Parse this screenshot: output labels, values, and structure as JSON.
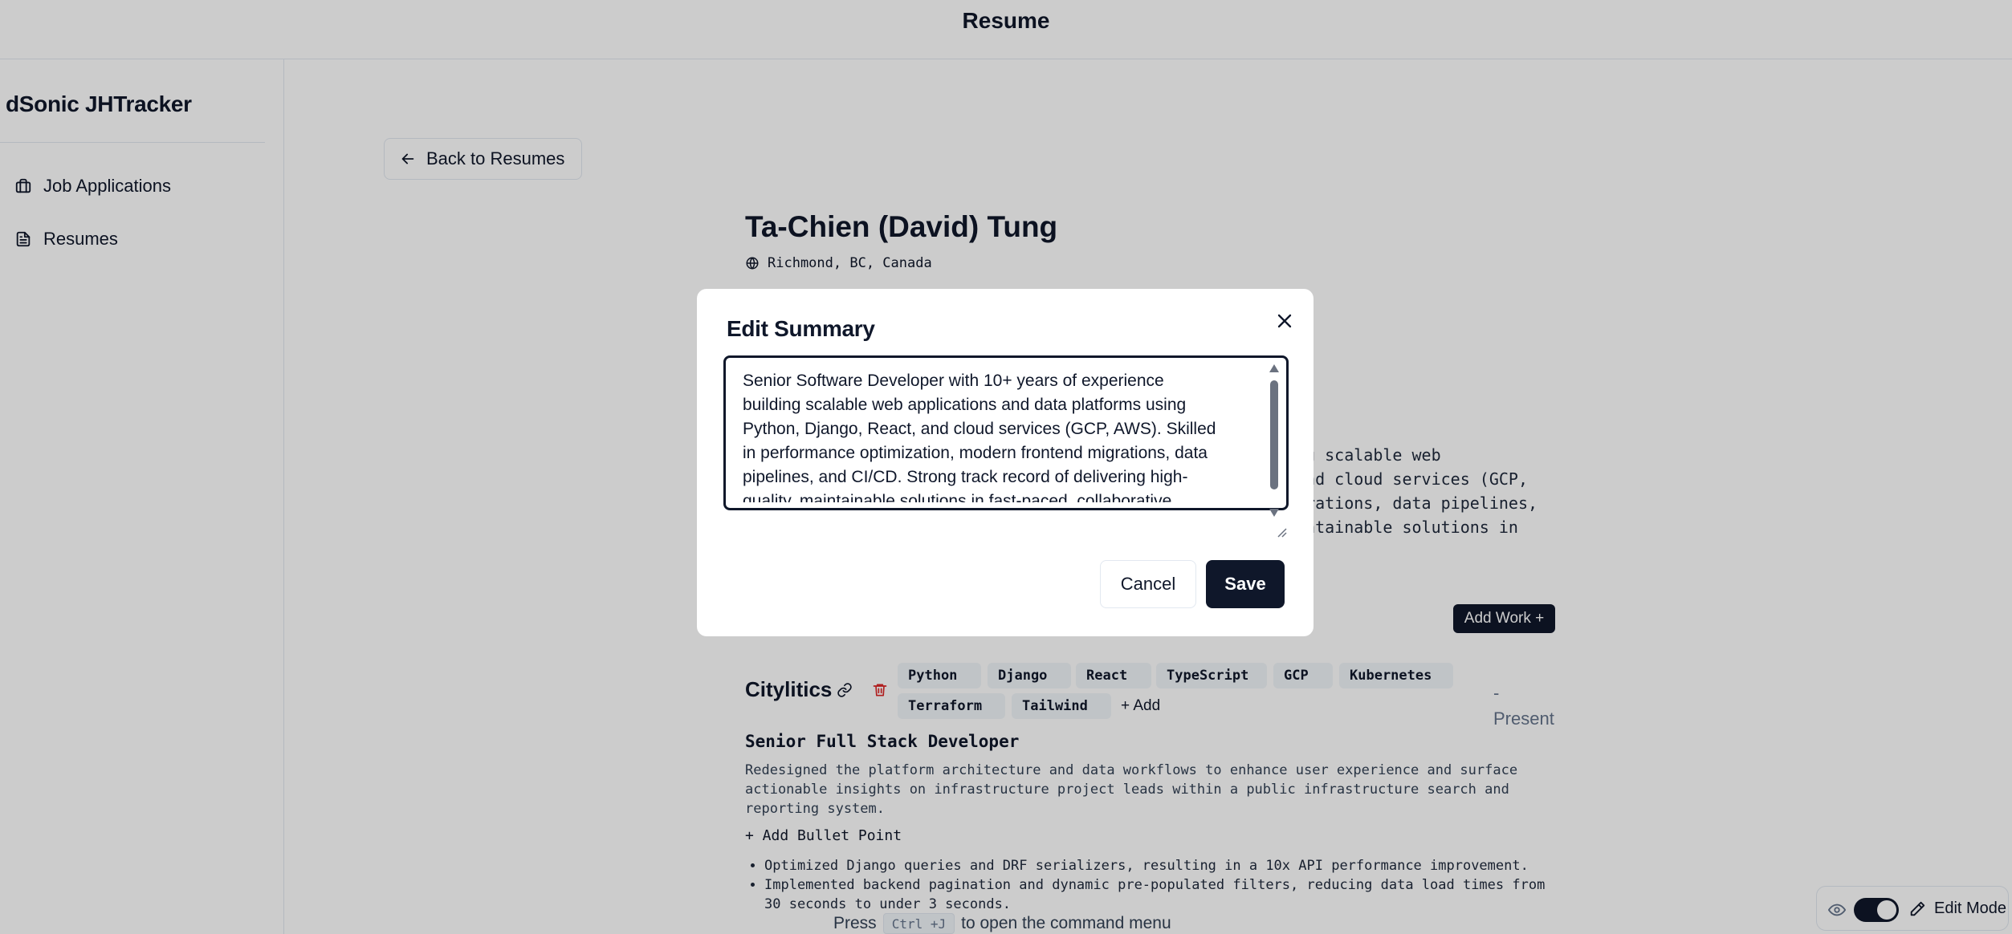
{
  "header": {
    "title": "Resume"
  },
  "sidebar": {
    "brand": "dSonic JHTracker",
    "items": [
      {
        "label": "Job Applications",
        "icon": "briefcase-icon"
      },
      {
        "label": "Resumes",
        "icon": "document-icon"
      }
    ]
  },
  "back_button": {
    "label": "Back to Resumes",
    "icon": "arrow-left-icon"
  },
  "resume": {
    "name": "Ta-Chien (David) Tung",
    "location": "Richmond, BC, Canada",
    "summary_lines": "ng scalable web\nand cloud services (GCP,\ngrations, data pipelines,\nintainable solutions in",
    "add_work_label": "Add Work +",
    "experience": {
      "company": "Citylitics",
      "skills": [
        "Python",
        "Django",
        "React",
        "TypeScript",
        "GCP",
        "Kubernetes",
        "Terraform",
        "Tailwind"
      ],
      "add_skill_label": "+ Add",
      "date_dash": "-",
      "date_end": "Present",
      "role": "Senior Full Stack Developer",
      "description": "Redesigned the platform architecture and data workflows to enhance user experience and surface\nactionable insights on infrastructure project leads within a public infrastructure search and\nreporting system.",
      "add_bullet_label": "+ Add Bullet Point",
      "bullets": [
        "Optimized Django queries and DRF serializers, resulting in a 10x API performance improvement.",
        "Implemented backend pagination and dynamic pre-populated filters, reducing data load times from 30 seconds to under 3 seconds."
      ]
    }
  },
  "command_hint": {
    "prefix": "Press",
    "key": "Ctrl +J",
    "suffix": "to open the command menu"
  },
  "edit_mode": {
    "label": "Edit Mode",
    "enabled": true
  },
  "modal": {
    "title": "Edit Summary",
    "textarea_value": "Senior Software Developer with 10+ years of experience\nbuilding scalable web applications and data platforms using\nPython, Django, React, and cloud services (GCP, AWS). Skilled\nin performance optimization, modern frontend migrations, data\npipelines, and CI/CD. Strong track record of delivering high-\nquality, maintainable solutions in fast-paced, collaborative\nenvironments.",
    "cancel_label": "Cancel",
    "save_label": "Save"
  },
  "colors": {
    "primary": "#0f172a",
    "danger": "#dc2626",
    "muted": "#64748b",
    "chip": "#f1f5f9"
  }
}
